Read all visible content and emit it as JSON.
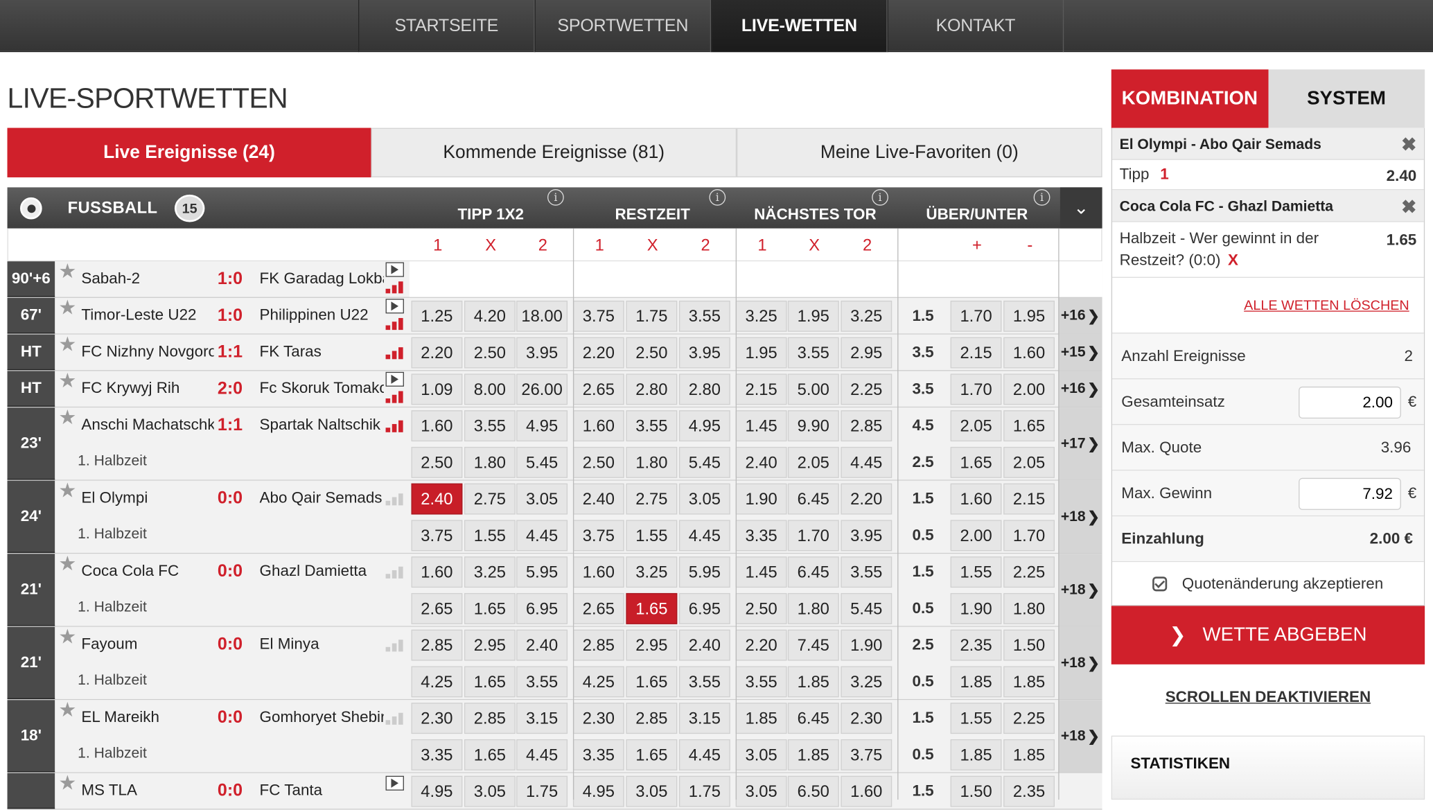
{
  "nav": {
    "items": [
      "STARTSEITE",
      "SPORTWETTEN",
      "LIVE-WETTEN",
      "KONTAKT"
    ],
    "active": 2
  },
  "page_title": "LIVE-SPORTWETTEN",
  "tabs": [
    "Live Ereignisse (24)",
    "Kommende Ereignisse (81)",
    "Meine Live-Favoriten (0)"
  ],
  "sport": {
    "name": "FUSSBALL",
    "count": "15"
  },
  "groups": [
    "TIPP 1X2",
    "RESTZEIT",
    "NÄCHSTES TOR",
    "ÜBER/UNTER"
  ],
  "subhead": {
    "one": "1",
    "x": "X",
    "two": "2",
    "plus": "+",
    "minus": "-"
  },
  "events": [
    {
      "time": "90'+6",
      "home": "Sabah-2",
      "score": "1:0",
      "away": "FK Garadag Lokbatan",
      "period": "",
      "more": "",
      "icons": "play-bars",
      "rows": []
    },
    {
      "time": "67'",
      "home": "Timor-Leste U22",
      "score": "1:0",
      "away": "Philippinen U22",
      "period": "",
      "more": "+16",
      "icons": "play-bars",
      "rows": [
        {
          "odds": [
            "1.25",
            "4.20",
            "18.00",
            "3.75",
            "1.75",
            "3.55",
            "3.25",
            "1.95",
            "3.25"
          ],
          "line": "1.5",
          "ou": [
            "1.70",
            "1.95"
          ]
        }
      ]
    },
    {
      "time": "HT",
      "home": "FC Nizhny Novgorod",
      "score": "1:1",
      "away": "FK Taras",
      "period": "",
      "more": "+15",
      "icons": "bars",
      "rows": [
        {
          "odds": [
            "2.20",
            "2.50",
            "3.95",
            "2.20",
            "2.50",
            "3.95",
            "1.95",
            "3.55",
            "2.95"
          ],
          "line": "3.5",
          "ou": [
            "2.15",
            "1.60"
          ]
        }
      ]
    },
    {
      "time": "HT",
      "home": "FC Krywyj Rih",
      "score": "2:0",
      "away": "Fc Skoruk Tomakovka",
      "period": "",
      "more": "+16",
      "icons": "play-bars",
      "rows": [
        {
          "odds": [
            "1.09",
            "8.00",
            "26.00",
            "2.65",
            "2.80",
            "2.80",
            "2.15",
            "5.00",
            "2.25"
          ],
          "line": "3.5",
          "ou": [
            "1.70",
            "2.00"
          ]
        }
      ]
    },
    {
      "time": "23'",
      "home": "Anschi Machatschkala",
      "score": "1:1",
      "away": "Spartak Naltschik",
      "period": "1. Halbzeit",
      "more": "+17",
      "icons": "bars",
      "rows": [
        {
          "odds": [
            "1.60",
            "3.55",
            "4.95",
            "1.60",
            "3.55",
            "4.95",
            "1.45",
            "9.90",
            "2.85"
          ],
          "line": "4.5",
          "ou": [
            "2.05",
            "1.65"
          ]
        },
        {
          "odds": [
            "2.50",
            "1.80",
            "5.45",
            "2.50",
            "1.80",
            "5.45",
            "2.40",
            "2.05",
            "4.45"
          ],
          "line": "2.5",
          "ou": [
            "1.65",
            "2.05"
          ]
        }
      ]
    },
    {
      "time": "24'",
      "home": "El Olympi",
      "score": "0:0",
      "away": "Abo Qair Semads",
      "period": "1. Halbzeit",
      "more": "+18",
      "icons": "grey",
      "sel": [
        0,
        0
      ],
      "rows": [
        {
          "odds": [
            "2.40",
            "2.75",
            "3.05",
            "2.40",
            "2.75",
            "3.05",
            "1.90",
            "6.45",
            "2.20"
          ],
          "line": "1.5",
          "ou": [
            "1.60",
            "2.15"
          ]
        },
        {
          "odds": [
            "3.75",
            "1.55",
            "4.45",
            "3.75",
            "1.55",
            "4.45",
            "3.35",
            "1.70",
            "3.95"
          ],
          "line": "0.5",
          "ou": [
            "2.00",
            "1.70"
          ]
        }
      ]
    },
    {
      "time": "21'",
      "home": "Coca Cola FC",
      "score": "0:0",
      "away": "Ghazl Damietta",
      "period": "1. Halbzeit",
      "more": "+18",
      "icons": "grey",
      "sel": [
        1,
        4
      ],
      "rows": [
        {
          "odds": [
            "1.60",
            "3.25",
            "5.95",
            "1.60",
            "3.25",
            "5.95",
            "1.45",
            "6.45",
            "3.55"
          ],
          "line": "1.5",
          "ou": [
            "1.55",
            "2.25"
          ]
        },
        {
          "odds": [
            "2.65",
            "1.65",
            "6.95",
            "2.65",
            "1.65",
            "6.95",
            "2.50",
            "1.80",
            "5.45"
          ],
          "line": "0.5",
          "ou": [
            "1.90",
            "1.80"
          ]
        }
      ]
    },
    {
      "time": "21'",
      "home": "Fayoum",
      "score": "0:0",
      "away": "El Minya",
      "period": "1. Halbzeit",
      "more": "+18",
      "icons": "grey",
      "rows": [
        {
          "odds": [
            "2.85",
            "2.95",
            "2.40",
            "2.85",
            "2.95",
            "2.40",
            "2.20",
            "7.45",
            "1.90"
          ],
          "line": "2.5",
          "ou": [
            "2.35",
            "1.50"
          ]
        },
        {
          "odds": [
            "4.25",
            "1.65",
            "3.55",
            "4.25",
            "1.65",
            "3.55",
            "3.55",
            "1.85",
            "3.25"
          ],
          "line": "0.5",
          "ou": [
            "1.85",
            "1.85"
          ]
        }
      ]
    },
    {
      "time": "18'",
      "home": "EL Mareikh",
      "score": "0:0",
      "away": "Gomhoryet Shebin",
      "period": "1. Halbzeit",
      "more": "+18",
      "icons": "grey",
      "rows": [
        {
          "odds": [
            "2.30",
            "2.85",
            "3.15",
            "2.30",
            "2.85",
            "3.15",
            "1.85",
            "6.45",
            "2.30"
          ],
          "line": "1.5",
          "ou": [
            "1.55",
            "2.25"
          ]
        },
        {
          "odds": [
            "3.35",
            "1.65",
            "4.45",
            "3.35",
            "1.65",
            "4.45",
            "3.05",
            "1.85",
            "3.75"
          ],
          "line": "0.5",
          "ou": [
            "1.85",
            "1.85"
          ]
        }
      ]
    },
    {
      "time": "",
      "home": "MS TLA",
      "score": "0:0",
      "away": "FC Tanta",
      "period": "",
      "more": "",
      "icons": "play",
      "rows": [
        {
          "odds": [
            "4.95",
            "3.05",
            "1.75",
            "4.95",
            "3.05",
            "1.75",
            "3.05",
            "6.50",
            "1.60"
          ],
          "line": "1.5",
          "ou": [
            "1.50",
            "2.35"
          ]
        }
      ]
    }
  ],
  "betslip": {
    "tabs": [
      "KOMBINATION",
      "SYSTEM"
    ],
    "bets": [
      {
        "match": "El Olympi - Abo Qair Semads",
        "label": "Tipp",
        "tip": "1",
        "quote": "2.40"
      },
      {
        "match": "Coca Cola FC - Ghazl Damietta",
        "label": "Halbzeit - Wer gewinnt in der Restzeit? (0:0)",
        "tip": "X",
        "quote": "1.65"
      }
    ],
    "delete_all": "ALLE WETTEN LÖSCHEN",
    "count_label": "Anzahl Ereignisse",
    "count": "2",
    "stake_label": "Gesamteinsatz",
    "stake": "2.00",
    "currency": "€",
    "maxquote_label": "Max. Quote",
    "maxquote": "3.96",
    "maxwin_label": "Max. Gewinn",
    "maxwin": "7.92",
    "deposit_label": "Einzahlung",
    "deposit": "2.00 €",
    "accept_label": "Quotenänderung akzeptieren",
    "submit": "WETTE ABGEBEN",
    "scroll_off": "SCROLLEN DEAKTIVIEREN",
    "stats": "STATISTIKEN"
  }
}
